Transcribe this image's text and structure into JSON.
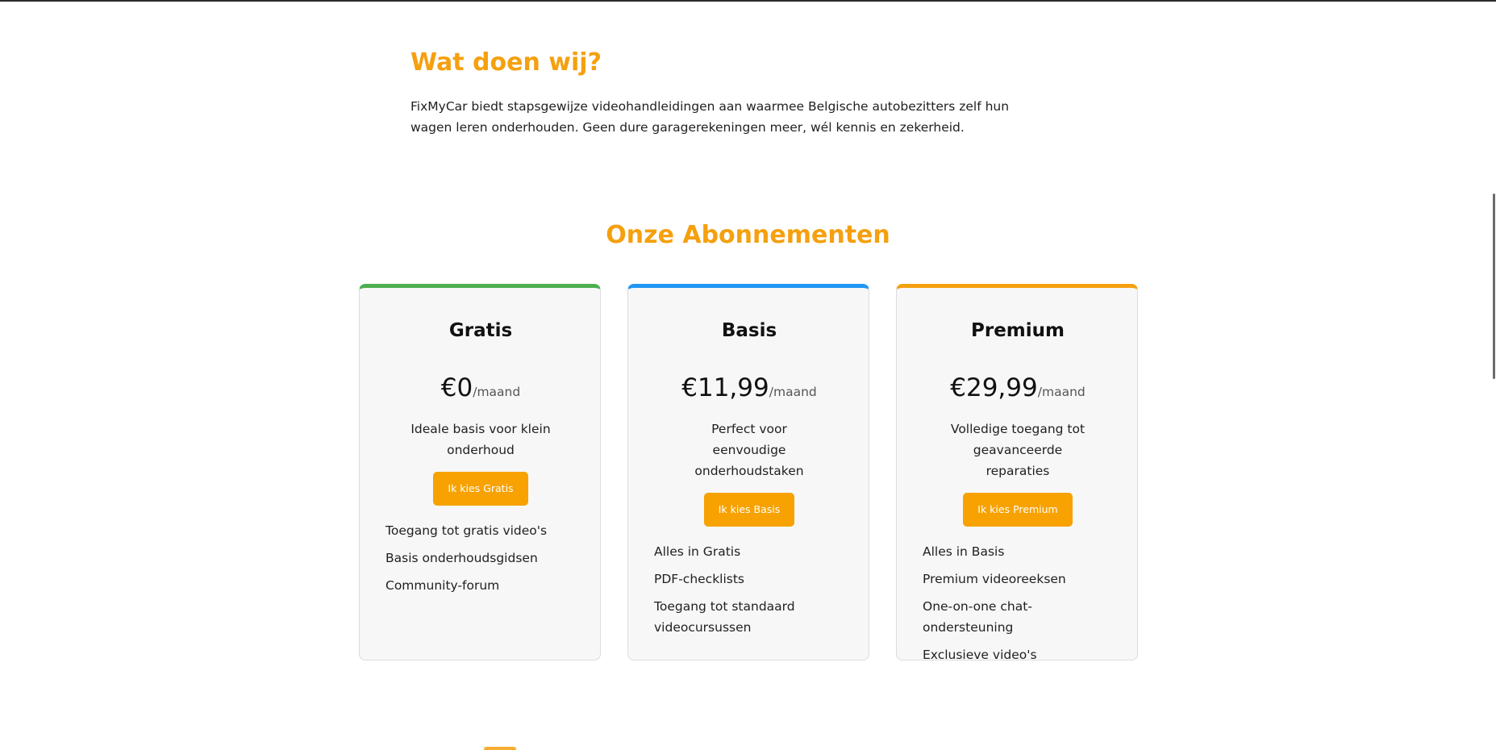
{
  "intro": {
    "title": "Wat doen wij?",
    "text": "FixMyCar biedt stapsgewijze videohandleidingen aan waarmee Belgische autobezitters zelf hun wagen leren onderhouden. Geen dure garagerekeningen meer, wél kennis en zekerheid."
  },
  "plans": {
    "title": "Onze Abonnementen",
    "items": [
      {
        "name": "Gratis",
        "price": "€0",
        "period": "/maand",
        "description": "Ideale basis voor klein onderhoud",
        "cta": "Ik kies Gratis",
        "accent": "#4caf50",
        "features": [
          "Toegang tot gratis video's",
          "Basis onderhoudsgidsen",
          "Community-forum"
        ]
      },
      {
        "name": "Basis",
        "price": "€11,99",
        "period": "/maand",
        "description": "Perfect voor eenvoudige onderhoudstaken",
        "cta": "Ik kies Basis",
        "accent": "#2196f3",
        "features": [
          "Alles in Gratis",
          "PDF-checklists",
          "Toegang tot standaard videocursussen"
        ]
      },
      {
        "name": "Premium",
        "price": "€29,99",
        "period": "/maand",
        "description": "Volledige toegang tot geavanceerde reparaties",
        "cta": "Ik kies Premium",
        "accent": "#f5a00f",
        "features": [
          "Alles in Basis",
          "Premium videoreeksen",
          "One-on-one chat-ondersteuning",
          "Exclusieve video's"
        ]
      }
    ]
  },
  "colors": {
    "heading": "#f5a00f",
    "button": "#f7a200",
    "card_bg": "#f7f7f7"
  }
}
